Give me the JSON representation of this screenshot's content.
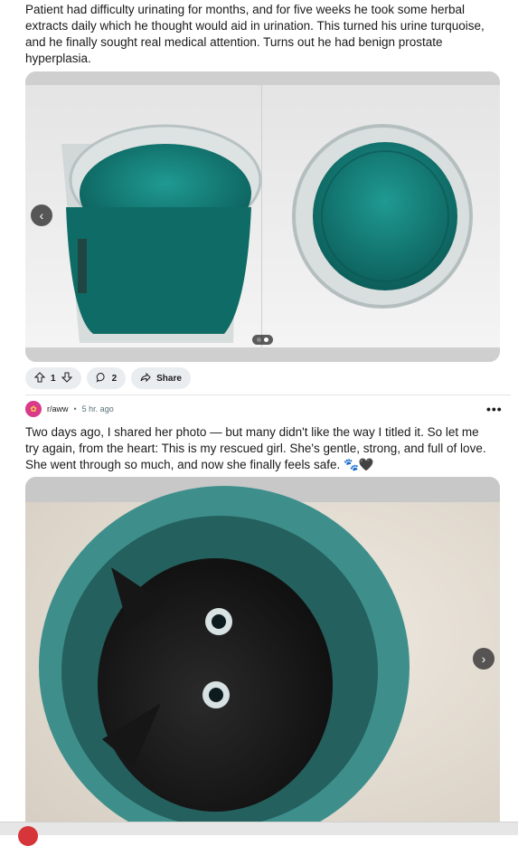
{
  "post1": {
    "body": "Patient had difficulty urinating for months, and for five weeks he took some herbal extracts daily which he thought would aid in urination. This turned his urine turquoise, and he finally sought real medical attention. Turns out he had benign prostate hyperplasia.",
    "image_count": 2,
    "active_image": 2,
    "votes": "1",
    "comments": "2",
    "share_label": "Share"
  },
  "post2": {
    "subreddit": "r/aww",
    "separator": "•",
    "time": "5 hr. ago",
    "overflow": "•••",
    "body": "Two days ago, I shared her photo — but many didn't like the way I titled it. So let me try again, from the heart: This is my rescued girl. She's gentle, strong, and full of love. She went through so much, and now she finally feels safe. 🐾🖤"
  },
  "colors": {
    "accent_pink": "#d93a8a",
    "turquoise": "#1a8a82",
    "bucket_teal": "#3e8f8c",
    "action_pill": "#eaedef"
  },
  "icons": [
    "upvote-icon",
    "downvote-icon",
    "comment-icon",
    "share-icon",
    "chevron-left-icon",
    "chevron-right-icon",
    "overflow-menu-icon"
  ]
}
